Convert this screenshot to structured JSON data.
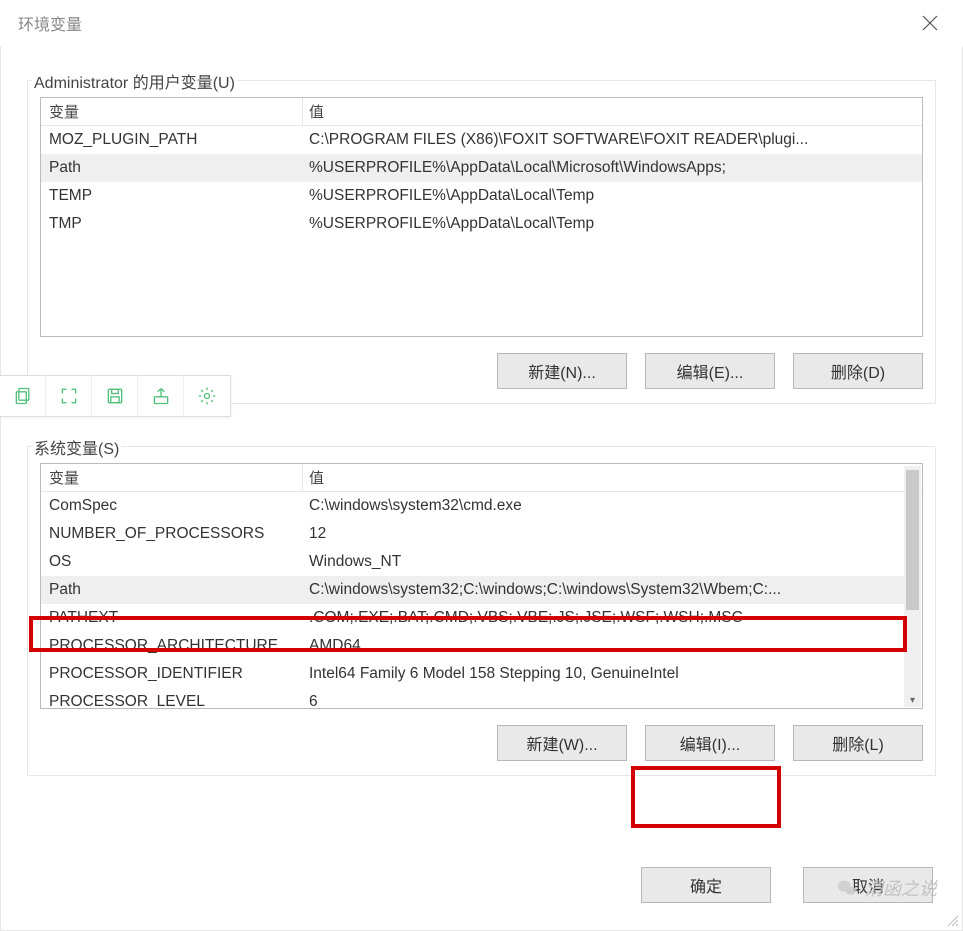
{
  "window": {
    "title": "环境变量"
  },
  "userVars": {
    "label": "Administrator 的用户变量(U)",
    "columns": {
      "name": "变量",
      "value": "值"
    },
    "rows": [
      {
        "name": "MOZ_PLUGIN_PATH",
        "value": "C:\\PROGRAM FILES (X86)\\FOXIT SOFTWARE\\FOXIT READER\\plugi..."
      },
      {
        "name": "Path",
        "value": "%USERPROFILE%\\AppData\\Local\\Microsoft\\WindowsApps;",
        "selected": true
      },
      {
        "name": "TEMP",
        "value": "%USERPROFILE%\\AppData\\Local\\Temp"
      },
      {
        "name": "TMP",
        "value": "%USERPROFILE%\\AppData\\Local\\Temp"
      }
    ],
    "buttons": {
      "new": "新建(N)...",
      "edit": "编辑(E)...",
      "del": "删除(D)"
    }
  },
  "sysVars": {
    "label": "系统变量(S)",
    "columns": {
      "name": "变量",
      "value": "值"
    },
    "rows": [
      {
        "name": "ComSpec",
        "value": "C:\\windows\\system32\\cmd.exe"
      },
      {
        "name": "NUMBER_OF_PROCESSORS",
        "value": "12"
      },
      {
        "name": "OS",
        "value": "Windows_NT"
      },
      {
        "name": "Path",
        "value": "C:\\windows\\system32;C:\\windows;C:\\windows\\System32\\Wbem;C:...",
        "selected": true
      },
      {
        "name": "PATHEXT",
        "value": ".COM;.EXE;.BAT;.CMD;.VBS;.VBE;.JS;.JSE;.WSF;.WSH;.MSC"
      },
      {
        "name": "PROCESSOR_ARCHITECTURE",
        "value": "AMD64"
      },
      {
        "name": "PROCESSOR_IDENTIFIER",
        "value": "Intel64 Family 6 Model 158 Stepping 10, GenuineIntel"
      },
      {
        "name": "PROCESSOR_LEVEL",
        "value": "6"
      }
    ],
    "buttons": {
      "new": "新建(W)...",
      "edit": "编辑(I)...",
      "del": "删除(L)"
    }
  },
  "dialog": {
    "ok": "确定",
    "cancel": "取消"
  },
  "watermark": "渭函之说"
}
